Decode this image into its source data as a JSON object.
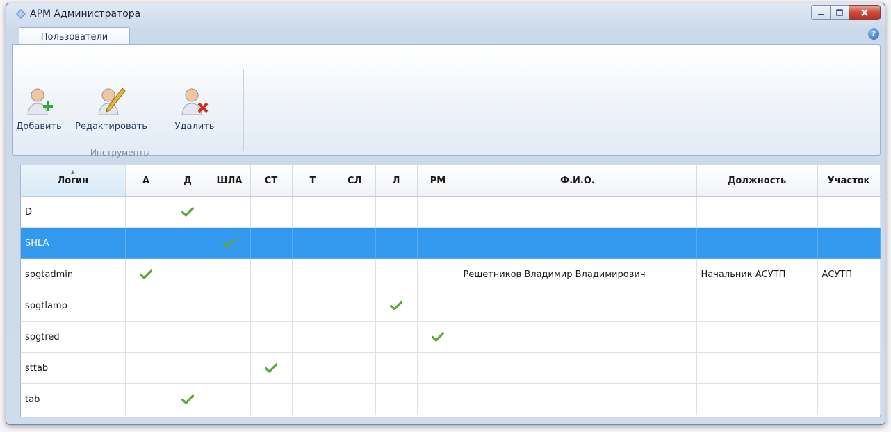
{
  "window": {
    "title": "АРМ Администратора"
  },
  "tabs": [
    {
      "label": "Пользователи"
    }
  ],
  "ribbon": {
    "group_label": "Инструменты",
    "buttons": {
      "add": "Добавить",
      "edit": "Редактировать",
      "delete": "Удалить"
    }
  },
  "table": {
    "columns": [
      "Логин",
      "А",
      "Д",
      "ШЛА",
      "СТ",
      "Т",
      "СЛ",
      "Л",
      "РМ",
      "Ф.И.О.",
      "Должность",
      "Участок"
    ],
    "sorted_column": "Логин",
    "selected_row": 1,
    "rows": [
      {
        "login": "D",
        "checks": [
          false,
          true,
          false,
          false,
          false,
          false,
          false,
          false
        ],
        "fio": "",
        "position": "",
        "area": ""
      },
      {
        "login": "SHLA",
        "checks": [
          false,
          false,
          true,
          false,
          false,
          false,
          false,
          false
        ],
        "fio": "",
        "position": "",
        "area": ""
      },
      {
        "login": "spgtadmin",
        "checks": [
          true,
          false,
          false,
          false,
          false,
          false,
          false,
          false
        ],
        "fio": "Решетников Владимир Владимирович",
        "position": "Начальник АСУТП",
        "area": "АСУТП"
      },
      {
        "login": "spgtlamp",
        "checks": [
          false,
          false,
          false,
          false,
          false,
          false,
          true,
          false
        ],
        "fio": "",
        "position": "",
        "area": ""
      },
      {
        "login": "spgtred",
        "checks": [
          false,
          false,
          false,
          false,
          false,
          false,
          false,
          true
        ],
        "fio": "",
        "position": "",
        "area": ""
      },
      {
        "login": "sttab",
        "checks": [
          false,
          false,
          false,
          true,
          false,
          false,
          false,
          false
        ],
        "fio": "",
        "position": "",
        "area": ""
      },
      {
        "login": "tab",
        "checks": [
          false,
          true,
          false,
          false,
          false,
          false,
          false,
          false
        ],
        "fio": "",
        "position": "",
        "area": ""
      }
    ]
  },
  "colors": {
    "selection": "#3399ee",
    "check": "#5aa83a",
    "delete": "#d42a1e",
    "add": "#3aa33a"
  }
}
